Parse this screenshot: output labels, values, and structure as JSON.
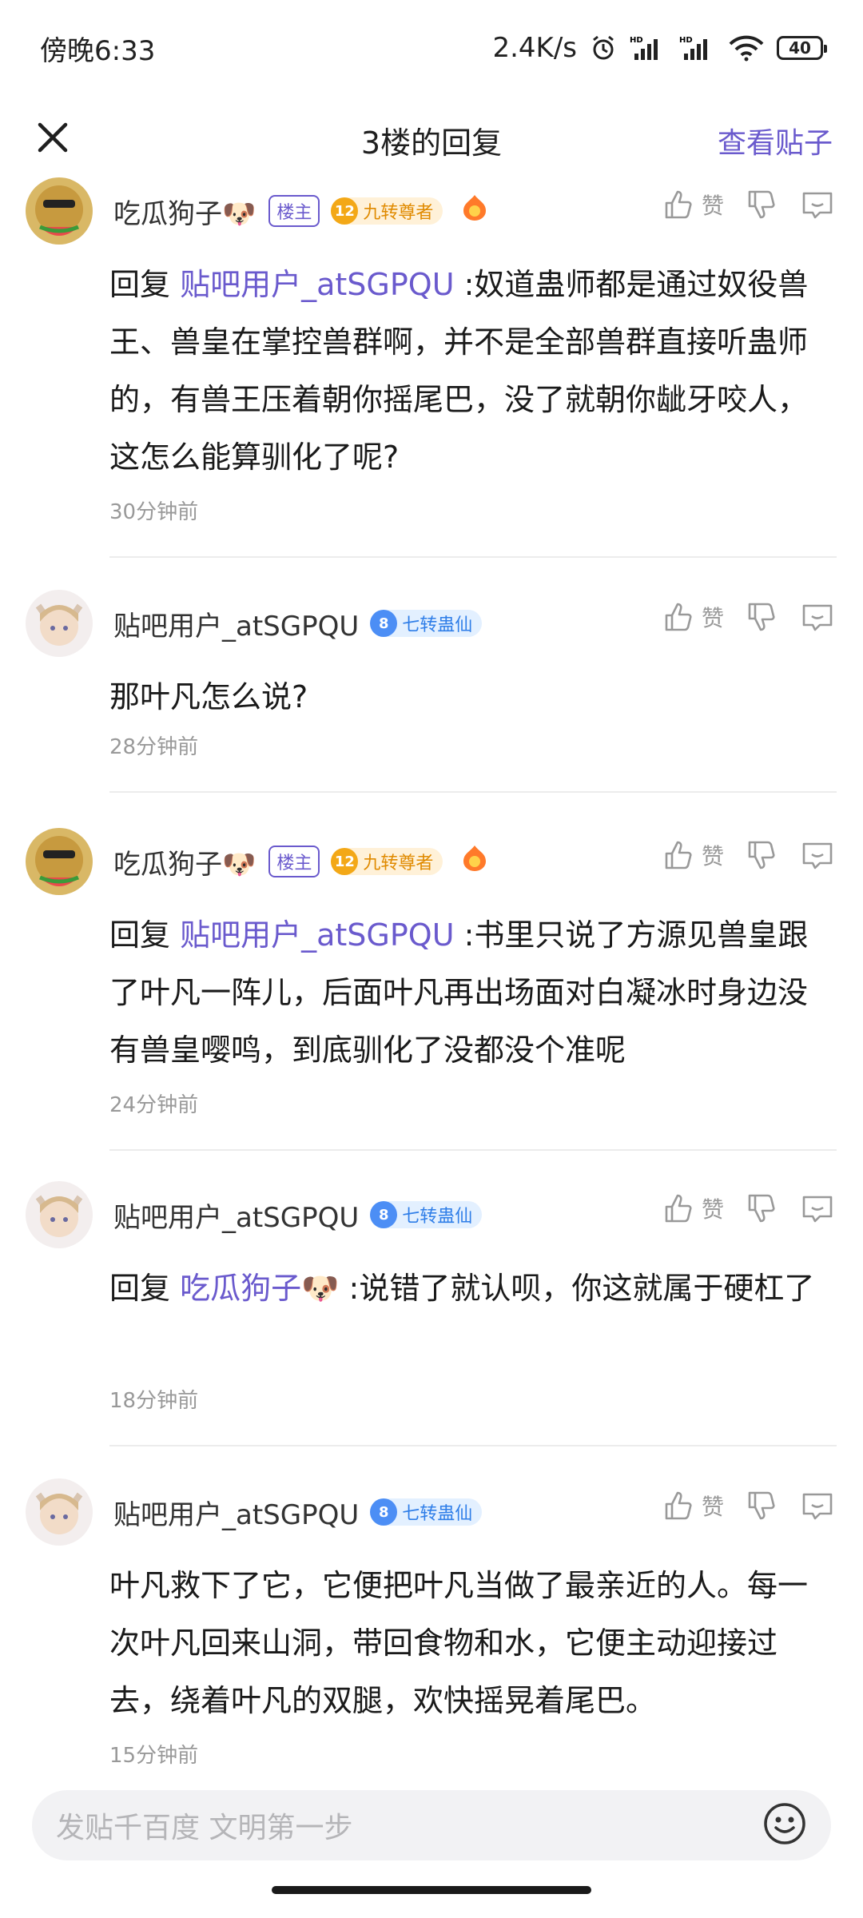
{
  "status_bar": {
    "time": "傍晚6:33",
    "net_speed": "2.4K/s",
    "battery": "40"
  },
  "header": {
    "title": "3楼的回复",
    "view_post": "查看贴子"
  },
  "like_label": "赞",
  "comments": [
    {
      "username": "吃瓜狗子🐶",
      "op_badge": "楼主",
      "level": "12",
      "level_title": "九转尊者",
      "reply_prefix": "回复",
      "mention": "贴吧用户_atSGPQU",
      "text": ":奴道蛊师都是通过奴役兽王、兽皇在掌控兽群啊，并不是全部兽群直接听蛊师的，有兽王压着朝你摇尾巴，没了就朝你龇牙咬人，这怎么能算驯化了呢?",
      "time": "30分钟前"
    },
    {
      "username": "贴吧用户_atSGPQU",
      "level": "8",
      "level_title": "七转蛊仙",
      "text": "那叶凡怎么说?",
      "time": "28分钟前"
    },
    {
      "username": "吃瓜狗子🐶",
      "op_badge": "楼主",
      "level": "12",
      "level_title": "九转尊者",
      "reply_prefix": "回复",
      "mention": "贴吧用户_atSGPQU",
      "text": ":书里只说了方源见兽皇跟了叶凡一阵儿，后面叶凡再出场面对白凝冰时身边没有兽皇嘤鸣，到底驯化了没都没个准呢",
      "time": "24分钟前"
    },
    {
      "username": "贴吧用户_atSGPQU",
      "level": "8",
      "level_title": "七转蛊仙",
      "reply_prefix": "回复",
      "mention": "吃瓜狗子🐶",
      "text": ":说错了就认呗，你这就属于硬杠了",
      "time": "18分钟前"
    },
    {
      "username": "贴吧用户_atSGPQU",
      "level": "8",
      "level_title": "七转蛊仙",
      "text": "叶凡救下了它，它便把叶凡当做了最亲近的人。每一次叶凡回来山洞，带回食物和水，它便主动迎接过去，绕着叶凡的双腿，欢快摇晃着尾巴。",
      "time": "15分钟前"
    }
  ],
  "input": {
    "placeholder": "发贴千百度 文明第一步"
  },
  "colors": {
    "accent": "#6a5acd",
    "gold_badge": "#f3a817",
    "blue_badge": "#4c8ef5"
  }
}
